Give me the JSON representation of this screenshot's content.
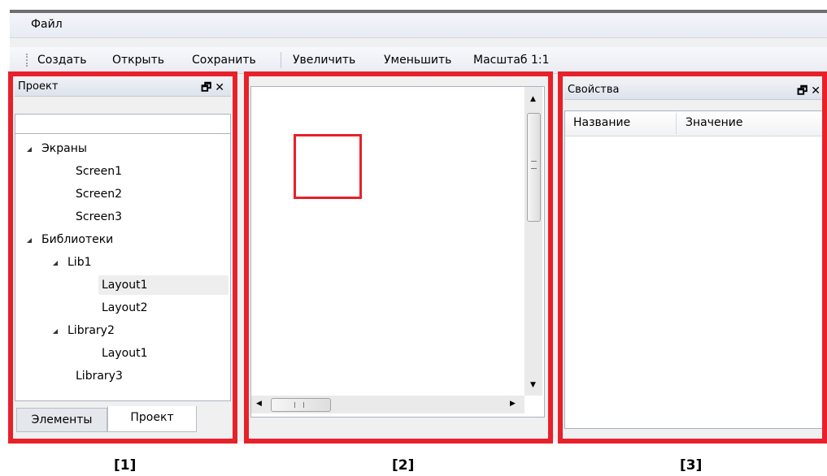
{
  "menu": {
    "file": "Файл"
  },
  "toolbar": {
    "create": "Создать",
    "open": "Открыть",
    "save": "Сохранить",
    "zoom_in": "Увеличить",
    "zoom_out": "Уменьшить",
    "scale": "Масштаб 1:1"
  },
  "project_panel": {
    "title": "Проект",
    "tree": {
      "screens": "Экраны",
      "screen1": "Screen1",
      "screen2": "Screen2",
      "screen3": "Screen3",
      "libraries": "Библиотеки",
      "lib1": "Lib1",
      "lib1_layout1": "Layout1",
      "lib1_layout2": "Layout2",
      "library2": "Library2",
      "library2_layout1": "Layout1",
      "library3": "Library3"
    },
    "tabs": {
      "elements": "Элементы",
      "project": "Проект"
    }
  },
  "properties_panel": {
    "title": "Свойства",
    "col_name": "Название",
    "col_value": "Значение"
  },
  "annotations": {
    "label1": "[1]",
    "label2": "[2]",
    "label3": "[3]",
    "color": "#e8202a"
  }
}
